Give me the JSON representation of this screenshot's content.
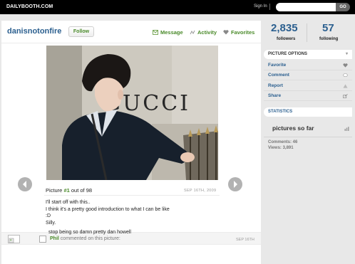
{
  "topbar": {
    "logo": "DAILYBOOTH.COM",
    "signin": "Sign In",
    "search_value": "",
    "go": "GO"
  },
  "profile": {
    "username": "danisnotonfire",
    "follow": "Follow",
    "tabs": {
      "message": "Message",
      "activity": "Activity",
      "favorites": "Favorites"
    }
  },
  "photo": {
    "sign_text": "GUCCI"
  },
  "picture": {
    "label": "Picture",
    "number": "#1",
    "out_of": "out of 98",
    "date": "SEP 16TH, 2009",
    "caption": [
      "I'll start off with this..",
      "I think it's a pretty good introduction to what I can be like",
      ":D",
      "Silly."
    ]
  },
  "comment": {
    "author": "Phil",
    "action": "commented on this picture:",
    "date": "SEP 16TH",
    "text": "stop being so damn pretty dan howell"
  },
  "sidebar": {
    "followers": {
      "count": "2,835",
      "label": "followers"
    },
    "following": {
      "count": "57",
      "label": "following"
    },
    "options": {
      "header": "PICTURE OPTIONS",
      "chevron": "▾",
      "items": [
        {
          "label": "Favorite",
          "icon": "heart-icon"
        },
        {
          "label": "Comment",
          "icon": "comment-icon"
        },
        {
          "label": "Report",
          "icon": "warning-icon"
        },
        {
          "label": "Share",
          "icon": "share-icon"
        }
      ]
    },
    "statistics": {
      "header": "STATISTICS",
      "pictures": "pictures so far",
      "comments": "Comments: 46",
      "views": "Views: 3,891"
    }
  },
  "colors": {
    "brand_blue": "#2b5f8f",
    "accent_green": "#4a8a2a",
    "topbar": "#000000"
  }
}
